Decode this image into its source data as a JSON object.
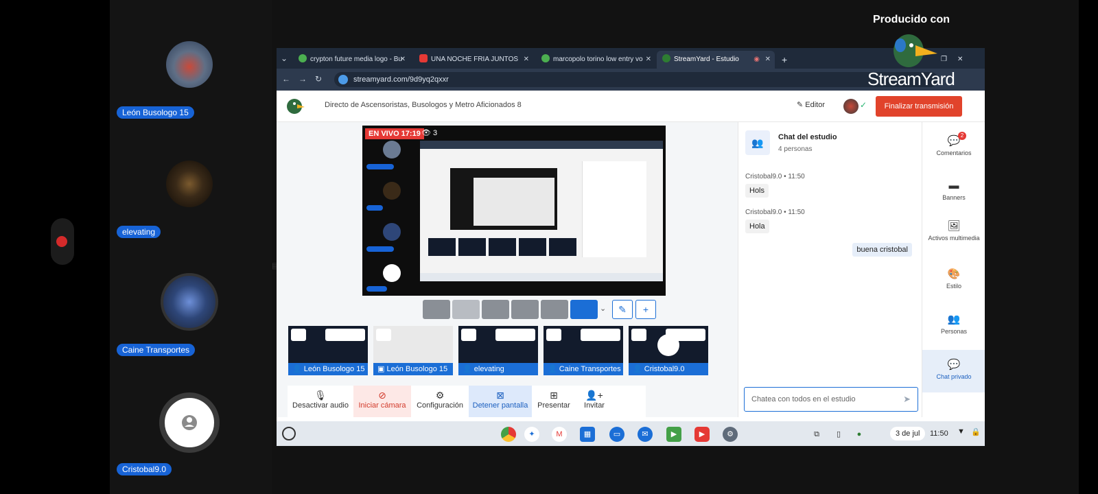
{
  "brand": {
    "produced_by": "Producido con",
    "logo": "StreamYard"
  },
  "participants": [
    {
      "name": "León Busologo 15"
    },
    {
      "name": "elevating"
    },
    {
      "name": "Caine Transportes"
    },
    {
      "name": "Cristobal9.0"
    }
  ],
  "browser": {
    "tabs": [
      {
        "label": "crypton future media logo - Bu",
        "icon_color": "#4caf50"
      },
      {
        "label": "UNA NOCHE FRIA JUNTOS",
        "icon_color": "#e53935"
      },
      {
        "label": "marcopolo torino low entry vo",
        "icon_color": "#4caf50"
      },
      {
        "label": "StreamYard - Estudio",
        "icon_color": "#2e7d32"
      }
    ],
    "url": "streamyard.com/9d9yq2qxxr"
  },
  "studio": {
    "title": "Directo de Ascensoristas, Busologos y Metro Aficionados 8",
    "editor_label": "Editor",
    "finalize_label": "Finalizar transmisión",
    "live_badge": "EN VIVO 17:19",
    "viewer_count": "3",
    "thumbnails": [
      {
        "label": "León Busologo 15"
      },
      {
        "label": "León Busologo 15"
      },
      {
        "label": "elevating"
      },
      {
        "label": "Caine Transportes"
      },
      {
        "label": "Cristobal9.0"
      }
    ],
    "controls": [
      {
        "label": "Desactivar audio",
        "icon": "mic-icon"
      },
      {
        "label": "Iniciar cámara",
        "icon": "camera-off-icon"
      },
      {
        "label": "Configuración",
        "icon": "gear-icon"
      },
      {
        "label": "Detener pantalla",
        "icon": "screen-stop-icon"
      },
      {
        "label": "Presentar",
        "icon": "present-icon"
      },
      {
        "label": "Invitar",
        "icon": "invite-icon"
      }
    ]
  },
  "chat": {
    "title": "Chat del estudio",
    "subtitle": "4 personas",
    "messages": [
      {
        "author": "Cristobal9.0",
        "time": "11:50",
        "text": "Hols"
      },
      {
        "author": "Cristobal9.0",
        "time": "11:50",
        "text": "Hola"
      }
    ],
    "my_message": "buena cristobal",
    "input_placeholder": "Chatea con todos en el estudio"
  },
  "rail": [
    {
      "label": "Comentarios",
      "badge": "2"
    },
    {
      "label": "Banners"
    },
    {
      "label": "Activos multimedia"
    },
    {
      "label": "Estilo"
    },
    {
      "label": "Personas"
    },
    {
      "label": "Chat privado"
    }
  ],
  "shelf": {
    "date": "3 de jul",
    "time": "11:50"
  },
  "colors": {
    "accent": "#1b6ed6",
    "live": "#e53935",
    "finalize": "#e1432b"
  }
}
